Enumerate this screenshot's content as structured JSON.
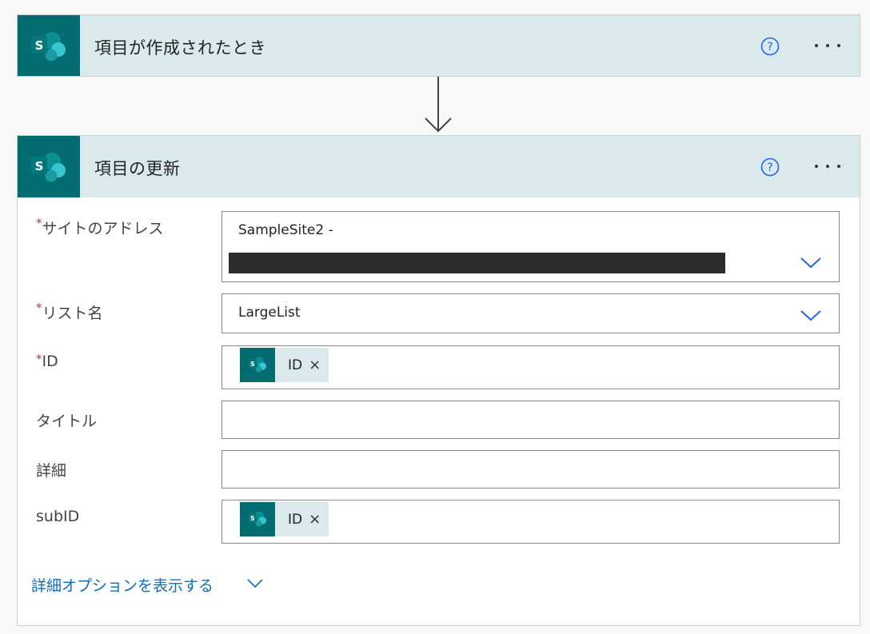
{
  "trigger": {
    "title": "項目が作成されたとき",
    "icon": "sharepoint-icon"
  },
  "action": {
    "title": "項目の更新",
    "icon": "sharepoint-icon"
  },
  "fields": {
    "site_address": {
      "required_mark": "*",
      "label": "サイトのアドレス",
      "value": "SampleSite2 -"
    },
    "list_name": {
      "required_mark": "*",
      "label": "リスト名",
      "value": "LargeList"
    },
    "id": {
      "required_mark": "*",
      "label": "ID",
      "token": "ID",
      "token_remove": "×"
    },
    "title": {
      "label": "タイトル",
      "value": ""
    },
    "detail": {
      "label": "詳細",
      "value": ""
    },
    "subid": {
      "label": "subID",
      "token": "ID",
      "token_remove": "×"
    }
  },
  "advanced_options_label": "詳細オプションを表示する",
  "colors": {
    "header_bg": "#dae9ec",
    "sharepoint_teal": "#036c70",
    "link_blue": "#0f6cbd",
    "required_red": "#c4314b"
  }
}
